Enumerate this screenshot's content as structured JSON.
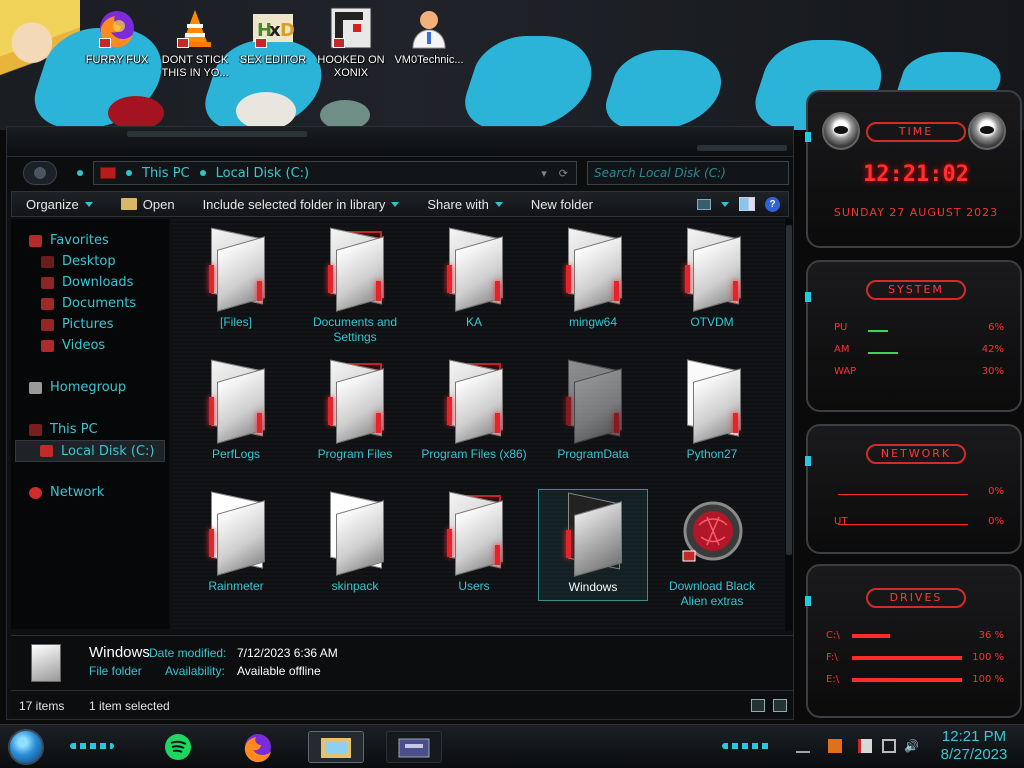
{
  "desktop": {
    "icons": [
      {
        "label": "FURRY FUX"
      },
      {
        "label": "DONT STICK THIS IN YO..."
      },
      {
        "label": "SEX EDITOR"
      },
      {
        "label": "HOOKED ON XONIX"
      },
      {
        "label": "VM0Technic..."
      }
    ]
  },
  "explorer": {
    "address": {
      "crumbs": [
        "This PC",
        "Local Disk (C:)"
      ],
      "search_placeholder": "Search Local Disk (C:)"
    },
    "toolbar": {
      "organize": "Organize",
      "open": "Open",
      "include": "Include selected folder in library",
      "share": "Share with",
      "new_folder": "New folder"
    },
    "nav": {
      "favorites": "Favorites",
      "desktop": "Desktop",
      "downloads": "Downloads",
      "documents": "Documents",
      "pictures": "Pictures",
      "videos": "Videos",
      "homegroup": "Homegroup",
      "this_pc": "This PC",
      "local_disk": "Local Disk (C:)",
      "network": "Network"
    },
    "files": [
      {
        "name": "[Files]"
      },
      {
        "name": "Documents and Settings"
      },
      {
        "name": "KA"
      },
      {
        "name": "mingw64"
      },
      {
        "name": "OTVDM"
      },
      {
        "name": "PerfLogs"
      },
      {
        "name": "Program Files"
      },
      {
        "name": "Program Files (x86)"
      },
      {
        "name": "ProgramData"
      },
      {
        "name": "Python27"
      },
      {
        "name": "Rainmeter"
      },
      {
        "name": "skinpack"
      },
      {
        "name": "Users"
      },
      {
        "name": "Windows"
      },
      {
        "name": "Download Black Alien extras"
      }
    ],
    "details": {
      "name": "Windows",
      "type": "File folder",
      "date_modified_label": "Date modified:",
      "date_modified": "7/12/2023 6:36 AM",
      "availability_label": "Availability:",
      "availability": "Available offline"
    },
    "status": {
      "items": "17 items",
      "selected": "1 item selected"
    }
  },
  "gadget": {
    "time_title": "TIME",
    "clock": "12:21:02",
    "date": "SUNDAY 27 AUGUST 2023",
    "system_title": "SYSTEM",
    "cpu_label": "PU",
    "cpu_value": "6%",
    "ram_label": "AM",
    "ram_value": "42%",
    "swap_label": "WAP",
    "swap_value": "30%",
    "network_title": "NETWORK",
    "net_in": "0%",
    "net_out_label": "UT",
    "net_out": "0%",
    "drives_title": "DRIVES",
    "drives": [
      {
        "label": "C:\\",
        "value": "36 %"
      },
      {
        "label": "F:\\",
        "value": "100 %"
      },
      {
        "label": "E:\\",
        "value": "100 %"
      }
    ]
  },
  "taskbar": {
    "time": "12:21 PM",
    "date": "8/27/2023"
  },
  "colors": {
    "accent": "#38c8d4",
    "alert": "#ff3030",
    "wallpaper_blue": "#2bb3d8"
  }
}
